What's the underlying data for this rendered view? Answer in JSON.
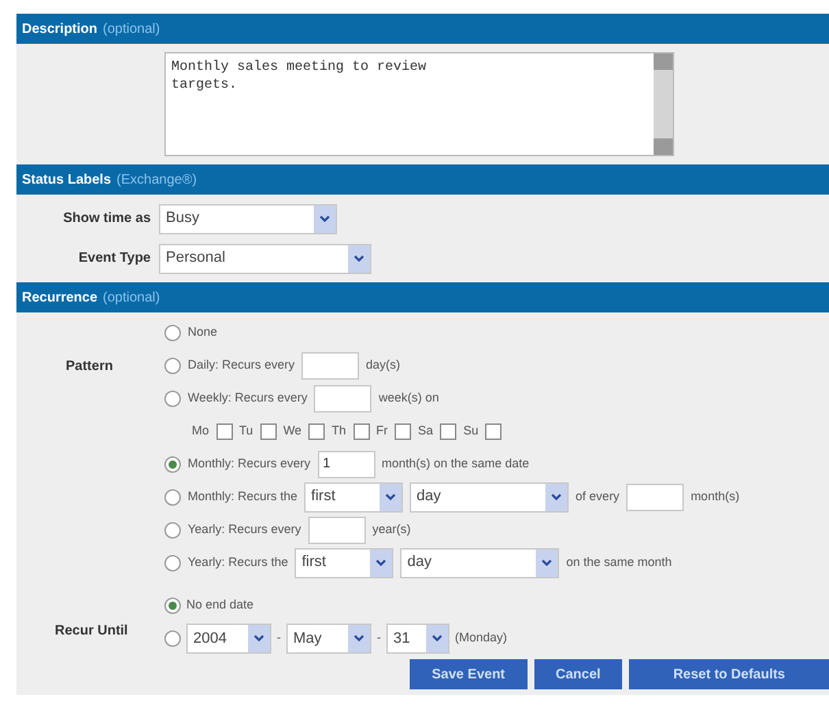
{
  "description": {
    "title": "Description",
    "note": "(optional)",
    "value": "Monthly sales meeting to review\ntargets."
  },
  "status_labels": {
    "title": "Status Labels",
    "note": "(Exchange®)",
    "fields": [
      {
        "label": "Show time as",
        "value": "Busy",
        "kind": "short"
      },
      {
        "label": "Event Type",
        "value": "Personal",
        "kind": "long"
      }
    ]
  },
  "recurrence": {
    "title": "Recurrence",
    "note": "(optional)",
    "pattern_label": "Pattern",
    "patterns": [
      {
        "selected": false,
        "parts": [
          {
            "kind": "text",
            "text": "None"
          }
        ]
      },
      {
        "selected": false,
        "parts": [
          {
            "kind": "text",
            "text": "Daily: Recurs every"
          },
          {
            "kind": "input"
          },
          {
            "kind": "text",
            "text": "day(s)"
          }
        ]
      },
      {
        "selected": false,
        "parts": [
          {
            "kind": "text",
            "text": "Weekly: Recurs every"
          },
          {
            "kind": "input"
          },
          {
            "kind": "text",
            "text": "week(s) on"
          }
        ],
        "days": [
          {
            "label": "Mo",
            "checked": false
          },
          {
            "label": "Tu",
            "checked": false
          },
          {
            "label": "We",
            "checked": false
          },
          {
            "label": "Th",
            "checked": false
          },
          {
            "label": "Fr",
            "checked": false
          },
          {
            "label": "Sa",
            "checked": false
          },
          {
            "label": "Su",
            "checked": false
          }
        ]
      },
      {
        "selected": true,
        "parts": [
          {
            "kind": "text",
            "text": "Monthly: Recurs every"
          },
          {
            "kind": "input",
            "value": "1"
          },
          {
            "kind": "text",
            "text": "month(s) on the same date"
          }
        ]
      },
      {
        "selected": false,
        "parts": [
          {
            "kind": "text",
            "text": "Monthly: Recurs the"
          },
          {
            "kind": "ordinal",
            "value": "first"
          },
          {
            "kind": "unit",
            "value": "day"
          },
          {
            "kind": "text",
            "text": "of every"
          },
          {
            "kind": "input"
          },
          {
            "kind": "text",
            "text": "month(s)"
          }
        ]
      },
      {
        "selected": false,
        "parts": [
          {
            "kind": "text",
            "text": "Yearly: Recurs every"
          },
          {
            "kind": "input"
          },
          {
            "kind": "text",
            "text": "year(s)"
          }
        ]
      },
      {
        "selected": false,
        "parts": [
          {
            "kind": "text",
            "text": "Yearly: Recurs the"
          },
          {
            "kind": "ordinal",
            "value": "first"
          },
          {
            "kind": "unit",
            "value": "day"
          },
          {
            "kind": "text",
            "text": "on the same month"
          }
        ]
      }
    ],
    "until_label": "Recur Until",
    "until": [
      {
        "selected": true,
        "parts": [
          {
            "kind": "text",
            "text": "No end date"
          }
        ]
      },
      {
        "selected": false,
        "parts": [
          {
            "kind": "year",
            "value": "2004"
          },
          {
            "kind": "text",
            "text": "-"
          },
          {
            "kind": "month",
            "value": "May"
          },
          {
            "kind": "text",
            "text": "-"
          },
          {
            "kind": "date",
            "value": "31"
          },
          {
            "kind": "text",
            "text": "(Monday)"
          }
        ]
      }
    ]
  },
  "buttons": [
    "Save Event",
    "Cancel",
    "Reset to Defaults"
  ]
}
